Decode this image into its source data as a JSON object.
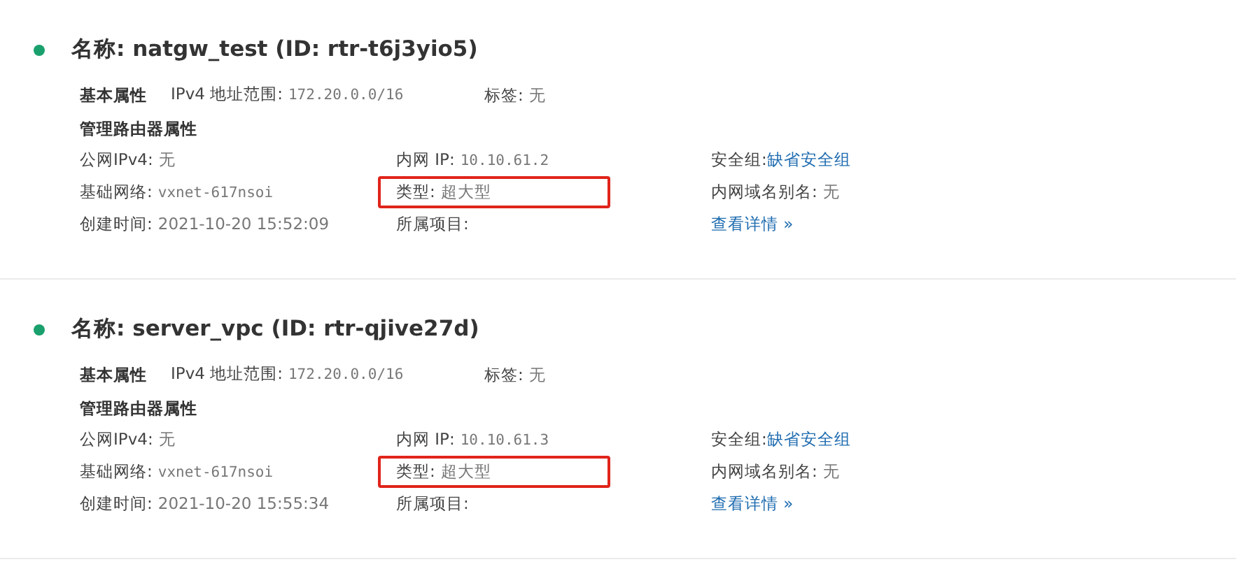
{
  "routers": [
    {
      "color": "#1aa06d",
      "title": "名称: natgw_test (ID: rtr-t6j3yio5)",
      "basic": {
        "heading": "基本属性",
        "fields": [
          {
            "label": "IPv4 地址范围:",
            "value": "172.20.0.0/16",
            "kind": "mono"
          },
          {
            "label": "标签:",
            "value": "无",
            "kind": "text"
          }
        ]
      },
      "manage": {
        "heading": "管理路由器属性",
        "fields": [
          {
            "label": "公网IPv4:",
            "value": "无",
            "kind": "text",
            "highlighted": false
          },
          {
            "label": "内网 IP:",
            "value": "10.10.61.2",
            "kind": "mono",
            "highlighted": false
          },
          {
            "label": "安全组:",
            "value": "缺省安全组",
            "kind": "link",
            "highlighted": false
          },
          {
            "label": "基础网络:",
            "value": "vxnet-617nsoi",
            "kind": "mono",
            "highlighted": false
          },
          {
            "label": "类型:",
            "value": "超大型",
            "kind": "text",
            "highlighted": true
          },
          {
            "label": "内网域名别名:",
            "value": "无",
            "kind": "text",
            "highlighted": false
          },
          {
            "label": "创建时间:",
            "value": "2021-10-20 15:52:09",
            "kind": "text",
            "highlighted": false
          },
          {
            "label": "所属项目:",
            "highlighted": false
          },
          {
            "value": "查看详情 »",
            "kind": "link",
            "highlighted": false
          }
        ]
      }
    },
    {
      "color": "#1aa06d",
      "title": "名称: server_vpc (ID: rtr-qjive27d)",
      "basic": {
        "heading": "基本属性",
        "fields": [
          {
            "label": "IPv4 地址范围:",
            "value": "172.20.0.0/16",
            "kind": "mono"
          },
          {
            "label": "标签:",
            "value": "无",
            "kind": "text"
          }
        ]
      },
      "manage": {
        "heading": "管理路由器属性",
        "fields": [
          {
            "label": "公网IPv4:",
            "value": "无",
            "kind": "text",
            "highlighted": false
          },
          {
            "label": "内网 IP:",
            "value": "10.10.61.3",
            "kind": "mono",
            "highlighted": false
          },
          {
            "label": "安全组:",
            "value": "缺省安全组",
            "kind": "link",
            "highlighted": false
          },
          {
            "label": "基础网络:",
            "value": "vxnet-617nsoi",
            "kind": "mono",
            "highlighted": false
          },
          {
            "label": "类型:",
            "value": "超大型",
            "kind": "text",
            "highlighted": true
          },
          {
            "label": "内网域名别名:",
            "value": "无",
            "kind": "text",
            "highlighted": false
          },
          {
            "label": "创建时间:",
            "value": "2021-10-20 15:55:34",
            "kind": "text",
            "highlighted": false
          },
          {
            "label": "所属项目:",
            "highlighted": false
          },
          {
            "value": "查看详情 »",
            "kind": "link",
            "highlighted": false
          }
        ]
      }
    }
  ]
}
